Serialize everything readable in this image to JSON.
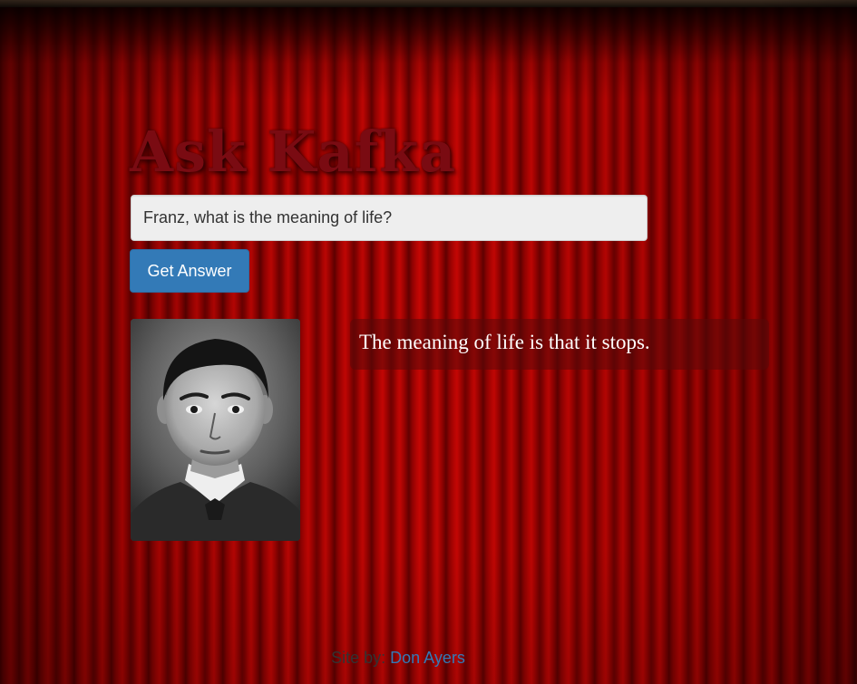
{
  "page": {
    "title": "Ask Kafka"
  },
  "form": {
    "question_value": "Franz, what is the meaning of life?",
    "button_label": "Get Answer"
  },
  "answer": {
    "text": "The meaning of life is that it stops."
  },
  "footer": {
    "prefix": "Site by:",
    "author": "Don Ayers"
  },
  "colors": {
    "title": "#7a0b12",
    "button": "#337ab7",
    "link": "#337ab7",
    "input_background": "#eeeeee"
  },
  "icons": {
    "portrait": "franz-kafka-portrait"
  }
}
